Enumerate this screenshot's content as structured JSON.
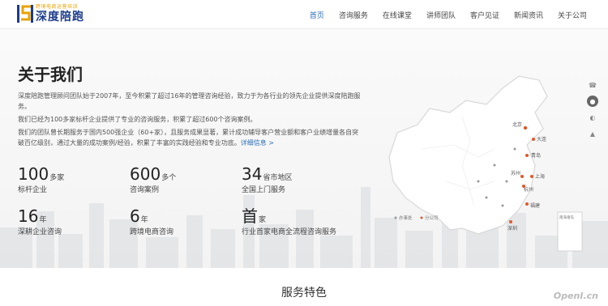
{
  "header": {
    "logo_sub": "跨境电商运营培训",
    "logo_main": "深度陪跑",
    "nav": [
      {
        "label": "首页",
        "active": true
      },
      {
        "label": "咨询服务"
      },
      {
        "label": "在线课堂"
      },
      {
        "label": "讲师团队"
      },
      {
        "label": "客户见证"
      },
      {
        "label": "新闻资讯"
      },
      {
        "label": "关于公司"
      }
    ]
  },
  "about": {
    "title": "关于我们",
    "paragraph1": "深度陪跑管理顾问团队始于2007年，至今积累了超过16年的管理咨询经验，致力于为各行业的领先企业提供深度陪跑服务。",
    "paragraph2": "我们已经为100多家标杆企业提供了专业的咨询服务，积累了超过600个咨询案例。",
    "paragraph3": "我们的团队曾长期服务于国内500强企业（60+家），且服务成果显著，累计成功辅导客户营业额和客户业绩增量各自突破百亿级别，通过大量的成功案例/经验，积累了丰富的实践经验和专业功底。",
    "more_link": "详细信息 >",
    "stats": [
      {
        "value": "100",
        "unit": "多家",
        "label": "标杆企业"
      },
      {
        "value": "600",
        "unit": "多个",
        "label": "咨询案例"
      },
      {
        "value": "34",
        "unit": "省市地区",
        "label": "全国上门服务"
      },
      {
        "value": "16",
        "unit": "年",
        "label": "深耕企业咨询"
      },
      {
        "value": "6",
        "unit": "年",
        "label": "跨境电商咨询"
      },
      {
        "value": "首",
        "unit": "家",
        "label": "行业首家电商全流程咨询服务"
      }
    ]
  },
  "map": {
    "cities": [
      "北京",
      "大连",
      "青岛",
      "苏州",
      "上海",
      "杭州",
      "福建",
      "深圳"
    ],
    "legend_office": "办事处",
    "legend_branch": "分公司",
    "inset_label": "南海诸岛"
  },
  "services": {
    "title": "服务特色"
  },
  "watermark": "OpenI.cn",
  "colors": {
    "accent": "#2c6eb8",
    "logo_blue": "#1c3c8c",
    "logo_gold": "#e8a200",
    "map_dot": "#e0582c"
  }
}
